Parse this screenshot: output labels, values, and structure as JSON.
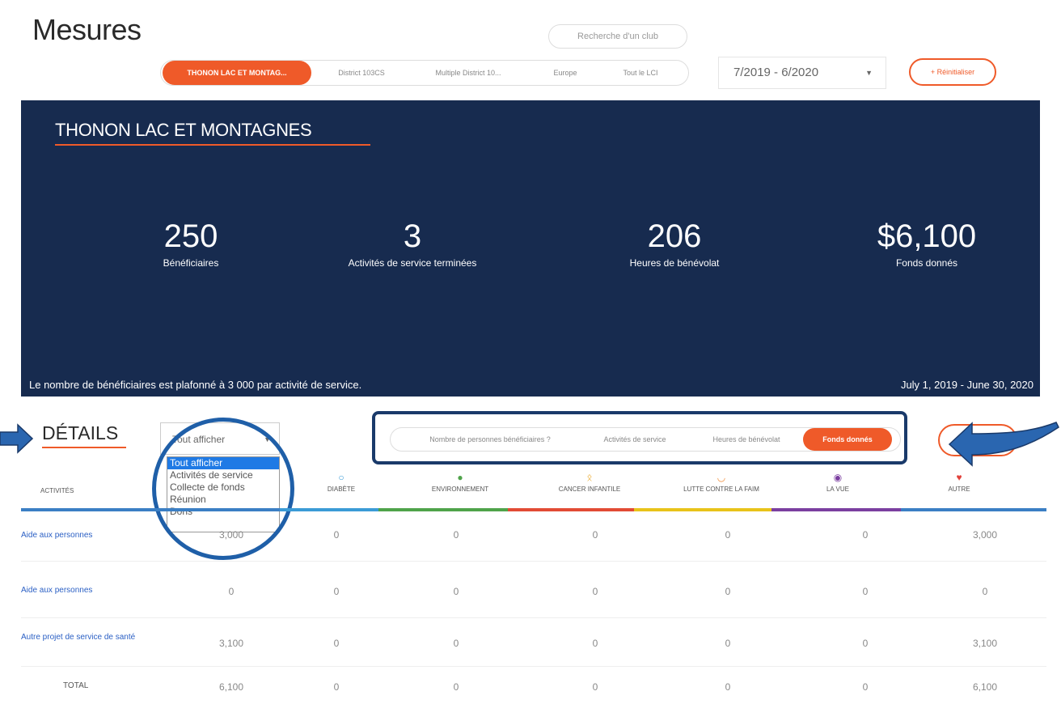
{
  "page": {
    "title": "Mesures"
  },
  "search": {
    "placeholder": "Recherche d'un club"
  },
  "scope_tabs": [
    {
      "label": "THONON LAC ET MONTAG...",
      "active": true
    },
    {
      "label": "District 103CS",
      "active": false
    },
    {
      "label": "Multiple District 10...",
      "active": false
    },
    {
      "label": "Europe",
      "active": false
    },
    {
      "label": "Tout le LCI",
      "active": false
    }
  ],
  "period": {
    "value": "7/2019 - 6/2020"
  },
  "reset_button": {
    "label": "+ Réinitialiser"
  },
  "banner": {
    "club_name": "THONON LAC ET MONTAGNES",
    "stats": [
      {
        "value": "250",
        "label": "Bénéficiaires"
      },
      {
        "value": "3",
        "label": "Activités de service terminées"
      },
      {
        "value": "206",
        "label": "Heures de bénévolat"
      },
      {
        "value": "$6,100",
        "label": "Fonds donnés"
      }
    ],
    "note": "Le nombre de bénéficiaires est plafonné à 3 000 par activité de service.",
    "date_range": "July 1, 2019 - June 30, 2020"
  },
  "details": {
    "title": "DÉTAILS",
    "filter": {
      "selected": "Tout afficher",
      "options": [
        "Tout afficher",
        "Activités de service",
        "Collecte de fonds",
        "Réunion",
        "Dons"
      ]
    },
    "metric_tabs": [
      {
        "label": "Nombre de personnes bénéficiaires ?",
        "active": false
      },
      {
        "label": "Activités de service",
        "active": false
      },
      {
        "label": "Heures de bénévolat",
        "active": false
      },
      {
        "label": "Fonds donnés",
        "active": true
      }
    ]
  },
  "table": {
    "activities_header": "ACTIVITÉS",
    "columns": [
      {
        "label": "DIABÈTE",
        "icon": "diabetes-icon",
        "color": "#3b9bd6"
      },
      {
        "label": "ENVIRONNEMENT",
        "icon": "leaf-icon",
        "color": "#4fa34a"
      },
      {
        "label": "CANCER INFANTILE",
        "icon": "ribbon-icon",
        "color": "#e8a117"
      },
      {
        "label": "LUTTE CONTRE LA FAIM",
        "icon": "bowl-icon",
        "color": "#f08a33"
      },
      {
        "label": "LA VUE",
        "icon": "eye-icon",
        "color": "#7b3fa0"
      },
      {
        "label": "AUTRE",
        "icon": "heart-icon",
        "color": "#e1413b"
      }
    ],
    "header_colors": [
      "#3b7fc4",
      "#3b9bd6",
      "#4fa34a",
      "#e24b35",
      "#e8c31a",
      "#7b3fa0",
      "#3b7fc4"
    ],
    "rows": [
      {
        "name": "Aide aux personnes",
        "values": [
          "3,000",
          "0",
          "0",
          "0",
          "0",
          "0",
          "3,000"
        ]
      },
      {
        "name": "Aide aux personnes",
        "values": [
          "0",
          "0",
          "0",
          "0",
          "0",
          "0",
          "0"
        ]
      },
      {
        "name": "Autre projet de service de santé",
        "values": [
          "3,100",
          "0",
          "0",
          "0",
          "0",
          "0",
          "3,100"
        ]
      }
    ],
    "total": {
      "label": "TOTAL",
      "values": [
        "6,100",
        "0",
        "0",
        "0",
        "0",
        "0",
        "6,100"
      ]
    }
  }
}
